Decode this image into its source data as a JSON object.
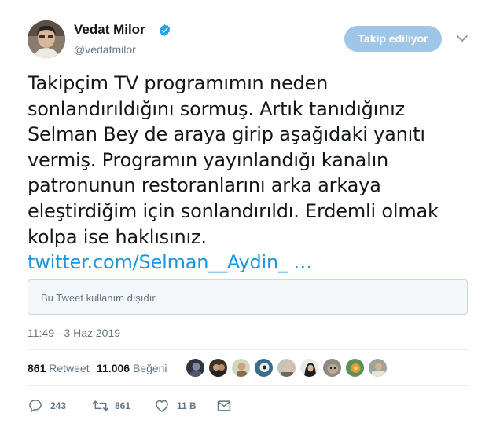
{
  "user": {
    "name": "Vedat Milor",
    "handle": "@vedatmilor",
    "verified_icon": "verified-badge-icon",
    "follow_label": "Takip ediliyor"
  },
  "tweet": {
    "lines": [
      "Takipçim TV programımın neden",
      "sonlandırıldığını sormuş. Artık tanıdığınız",
      "Selman Bey de araya girip aşağıdaki yanıtı",
      "vermiş. Programın yayınlandığı kanalın",
      "patronunun restoranlarını arka arkaya",
      "eleştirdiğim için sonlandırıldı. Erdemli olmak",
      "kolpa ise haklısınız."
    ],
    "link": "twitter.com/Selman__Aydin_ …",
    "withheld_notice": "Bu Tweet kullanım dışıdır.",
    "timestamp": "11:49 - 3 Haz 2019"
  },
  "stats": {
    "retweets_count": "861",
    "retweets_label": "Retweet",
    "likes_count": "11.006",
    "likes_label": "Beğeni"
  },
  "actions": {
    "reply_count": "243",
    "retweet_count": "861",
    "like_count": "11 B"
  },
  "colors": {
    "link": "#1b95e0",
    "follow_button": "#9fc6e8",
    "muted_text": "#657786",
    "verified": "#1da1f2"
  }
}
